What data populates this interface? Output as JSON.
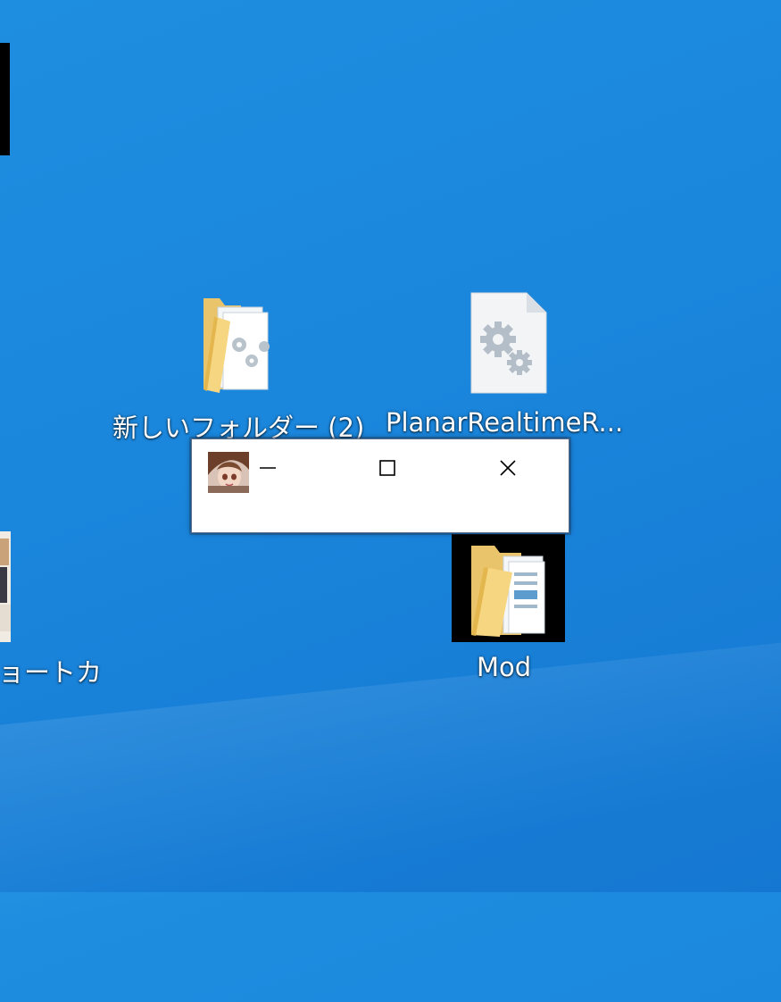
{
  "desktop": {
    "icons": [
      {
        "label": "新しいフォルダー (2)",
        "icon": "folder-with-files-icon"
      },
      {
        "label": "PlanarRealtimeR...",
        "icon": "settings-file-icon"
      },
      {
        "label": "Mod",
        "icon": "folder-icon"
      },
      {
        "label": "ョートカ",
        "icon": "shortcut-image-icon"
      }
    ]
  },
  "dialog": {
    "app_icon": "anime-avatar-icon",
    "controls": [
      "minimize-icon",
      "maximize-icon",
      "close-icon"
    ]
  }
}
